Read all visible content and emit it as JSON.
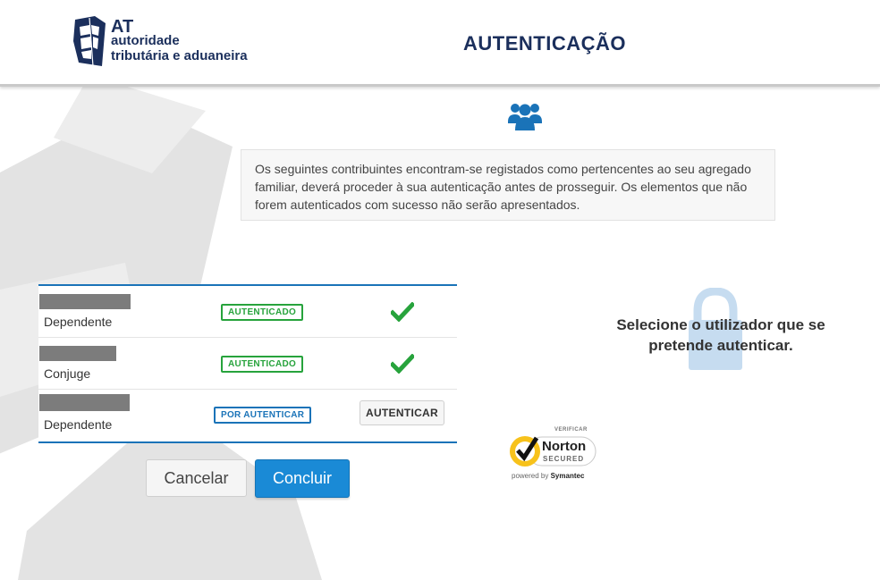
{
  "header": {
    "logo_at": "AT",
    "logo_line1": "autoridade",
    "logo_line2": "tributária e aduaneira",
    "title": "AUTENTICAÇÃO"
  },
  "info": {
    "icon": "users-icon",
    "text": "Os seguintes contribuintes encontram-se registados como pertencentes ao seu agregado familiar, deverá proceder à sua autenticação antes de prosseguir. Os elementos que não forem autenticados com sucesso não serão apresentados."
  },
  "members": [
    {
      "name": "",
      "role": "Dependente",
      "status": "AUTENTICADO",
      "authenticated": true
    },
    {
      "name": "",
      "role": "Conjuge",
      "status": "AUTENTICADO",
      "authenticated": true
    },
    {
      "name": "",
      "role": "Dependente",
      "status": "POR AUTENTICAR",
      "authenticated": false,
      "action_label": "AUTENTICAR"
    }
  ],
  "actions": {
    "cancel_label": "Cancelar",
    "confirm_label": "Concluir"
  },
  "norton": {
    "verify": "VERIFICAR",
    "name": "Norton",
    "secured": "SECURED",
    "powered_prefix": "powered by",
    "powered_brand": "Symantec"
  },
  "side": {
    "icon": "lock-icon",
    "message": "Selecione o utilizador que se pretende autenticar."
  },
  "colors": {
    "brand": "#1b2f5c",
    "primary": "#1a8ad6",
    "success": "#27a33c",
    "pending": "#1a73b8"
  }
}
